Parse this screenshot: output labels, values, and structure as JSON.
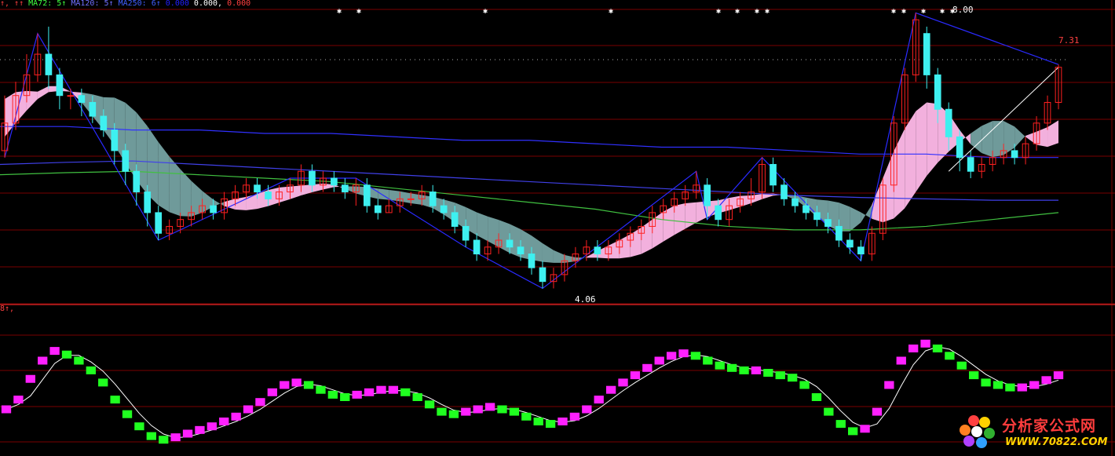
{
  "colors": {
    "bg": "#000000",
    "grid": "#7a0000",
    "up": "#ff2020",
    "down": "#3ef0f0",
    "pink": "#f2b0dd",
    "gray": "#6f9a9a",
    "zig": "#2a2aff",
    "zig2": "#ff40ff",
    "ma72": "#3030ff",
    "ma120": "#4040e8",
    "ma250": "#40c040",
    "osc_up": "#ff20ff",
    "osc_down": "#20ff20"
  },
  "legend": {
    "p1": "↑, ↑↑",
    "ma72": "MA72: 5↑",
    "ma120": "MA120: 5↑",
    "ma250": "MA250: 6↑",
    "v1": "0.000",
    "v2": "0.000,",
    "v3": "0.000",
    "p2": "8↑,"
  },
  "chart_data": [
    {
      "type": "candlestick",
      "annotations": {
        "high_label": "8.00",
        "low_label": "4.06",
        "last_label": "7.31"
      },
      "ylim": [
        3.9,
        8.15
      ],
      "candles": [
        [
          6.1,
          6.5,
          6.9,
          6.0
        ],
        [
          6.5,
          6.9,
          7.1,
          6.4
        ],
        [
          6.9,
          7.2,
          7.5,
          6.8
        ],
        [
          7.2,
          7.5,
          7.8,
          7.1
        ],
        [
          7.5,
          7.2,
          7.9,
          7.0
        ],
        [
          7.2,
          6.9,
          7.3,
          6.7
        ],
        [
          6.9,
          6.9,
          7.0,
          6.7
        ],
        [
          6.9,
          6.8,
          7.0,
          6.6
        ],
        [
          6.8,
          6.6,
          6.9,
          6.5
        ],
        [
          6.6,
          6.4,
          6.7,
          6.3
        ],
        [
          6.4,
          6.1,
          6.5,
          5.9
        ],
        [
          6.1,
          5.8,
          6.2,
          5.6
        ],
        [
          5.8,
          5.5,
          5.9,
          5.3
        ],
        [
          5.5,
          5.2,
          5.6,
          5.0
        ],
        [
          5.2,
          4.9,
          5.3,
          4.8
        ],
        [
          4.9,
          5.0,
          5.1,
          4.8
        ],
        [
          5.0,
          5.1,
          5.2,
          4.9
        ],
        [
          5.1,
          5.2,
          5.3,
          5.0
        ],
        [
          5.2,
          5.3,
          5.4,
          5.1
        ],
        [
          5.3,
          5.2,
          5.4,
          5.1
        ],
        [
          5.2,
          5.4,
          5.5,
          5.1
        ],
        [
          5.4,
          5.5,
          5.6,
          5.3
        ],
        [
          5.5,
          5.6,
          5.7,
          5.4
        ],
        [
          5.6,
          5.5,
          5.7,
          5.4
        ],
        [
          5.5,
          5.4,
          5.6,
          5.3
        ],
        [
          5.4,
          5.5,
          5.6,
          5.3
        ],
        [
          5.5,
          5.6,
          5.7,
          5.4
        ],
        [
          5.6,
          5.8,
          5.9,
          5.5
        ],
        [
          5.8,
          5.6,
          5.9,
          5.5
        ],
        [
          5.6,
          5.7,
          5.8,
          5.5
        ],
        [
          5.7,
          5.6,
          5.8,
          5.5
        ],
        [
          5.6,
          5.5,
          5.7,
          5.4
        ],
        [
          5.5,
          5.6,
          5.7,
          5.3
        ],
        [
          5.6,
          5.3,
          5.7,
          5.2
        ],
        [
          5.3,
          5.2,
          5.4,
          5.1
        ],
        [
          5.2,
          5.3,
          5.4,
          5.2
        ],
        [
          5.3,
          5.4,
          5.5,
          5.2
        ],
        [
          5.4,
          5.4,
          5.5,
          5.3
        ],
        [
          5.4,
          5.5,
          5.6,
          5.3
        ],
        [
          5.5,
          5.3,
          5.6,
          5.2
        ],
        [
          5.3,
          5.2,
          5.4,
          5.1
        ],
        [
          5.2,
          5.0,
          5.3,
          4.9
        ],
        [
          5.0,
          4.8,
          5.1,
          4.7
        ],
        [
          4.8,
          4.6,
          4.9,
          4.5
        ],
        [
          4.6,
          4.7,
          4.8,
          4.5
        ],
        [
          4.7,
          4.8,
          4.9,
          4.6
        ],
        [
          4.8,
          4.7,
          4.9,
          4.6
        ],
        [
          4.7,
          4.6,
          4.8,
          4.5
        ],
        [
          4.6,
          4.4,
          4.7,
          4.3
        ],
        [
          4.4,
          4.2,
          4.5,
          4.1
        ],
        [
          4.2,
          4.3,
          4.4,
          4.1
        ],
        [
          4.3,
          4.5,
          4.6,
          4.2
        ],
        [
          4.5,
          4.6,
          4.7,
          4.4
        ],
        [
          4.6,
          4.7,
          4.8,
          4.5
        ],
        [
          4.7,
          4.6,
          4.8,
          4.5
        ],
        [
          4.6,
          4.7,
          4.8,
          4.5
        ],
        [
          4.7,
          4.8,
          4.9,
          4.6
        ],
        [
          4.8,
          4.9,
          5.0,
          4.7
        ],
        [
          4.9,
          5.0,
          5.1,
          4.8
        ],
        [
          5.0,
          5.2,
          5.3,
          4.9
        ],
        [
          5.2,
          5.3,
          5.4,
          5.1
        ],
        [
          5.3,
          5.4,
          5.5,
          5.2
        ],
        [
          5.4,
          5.5,
          5.6,
          5.3
        ],
        [
          5.5,
          5.6,
          5.8,
          5.4
        ],
        [
          5.6,
          5.3,
          5.7,
          5.1
        ],
        [
          5.3,
          5.1,
          5.4,
          5.0
        ],
        [
          5.1,
          5.3,
          5.4,
          5.0
        ],
        [
          5.3,
          5.4,
          5.5,
          5.2
        ],
        [
          5.4,
          5.5,
          5.7,
          5.3
        ],
        [
          5.5,
          5.9,
          6.0,
          5.4
        ],
        [
          5.9,
          5.6,
          6.0,
          5.5
        ],
        [
          5.6,
          5.4,
          5.7,
          5.3
        ],
        [
          5.4,
          5.3,
          5.5,
          5.2
        ],
        [
          5.3,
          5.2,
          5.4,
          5.1
        ],
        [
          5.2,
          5.1,
          5.3,
          5.0
        ],
        [
          5.1,
          5.0,
          5.2,
          4.9
        ],
        [
          5.0,
          4.8,
          5.1,
          4.7
        ],
        [
          4.8,
          4.7,
          4.9,
          4.6
        ],
        [
          4.7,
          4.6,
          4.8,
          4.5
        ],
        [
          4.6,
          4.9,
          5.0,
          4.5
        ],
        [
          4.9,
          5.6,
          5.7,
          4.8
        ],
        [
          5.6,
          6.5,
          6.6,
          5.5
        ],
        [
          6.5,
          7.2,
          7.3,
          6.4
        ],
        [
          7.2,
          8.0,
          8.1,
          7.1
        ],
        [
          7.8,
          7.2,
          7.9,
          7.0
        ],
        [
          7.2,
          6.7,
          7.3,
          6.5
        ],
        [
          6.7,
          6.3,
          6.8,
          6.1
        ],
        [
          6.3,
          6.0,
          6.4,
          5.8
        ],
        [
          6.0,
          5.8,
          6.1,
          5.7
        ],
        [
          5.8,
          5.9,
          6.0,
          5.7
        ],
        [
          5.9,
          6.0,
          6.1,
          5.8
        ],
        [
          6.0,
          6.1,
          6.2,
          5.9
        ],
        [
          6.1,
          6.0,
          6.2,
          5.9
        ],
        [
          6.0,
          6.2,
          6.3,
          5.9
        ],
        [
          6.2,
          6.5,
          6.6,
          6.1
        ],
        [
          6.5,
          6.8,
          6.9,
          6.4
        ],
        [
          6.8,
          7.31,
          7.35,
          6.7
        ]
      ]
    },
    {
      "type": "line",
      "series": [
        {
          "name": "MA72",
          "values": [
            6.45,
            6.45,
            6.4,
            6.4,
            6.35,
            6.35,
            6.3,
            6.25,
            6.25,
            6.2,
            6.15,
            6.15,
            6.1,
            6.05,
            6.05,
            6.0,
            6.0
          ]
        },
        {
          "name": "MA120",
          "values": [
            5.9,
            5.93,
            5.95,
            5.9,
            5.85,
            5.8,
            5.75,
            5.7,
            5.65,
            5.6,
            5.55,
            5.5,
            5.45,
            5.42,
            5.4,
            5.38,
            5.38
          ]
        },
        {
          "name": "MA250",
          "values": [
            5.75,
            5.78,
            5.8,
            5.75,
            5.7,
            5.65,
            5.55,
            5.45,
            5.35,
            5.25,
            5.1,
            5.0,
            4.95,
            4.95,
            5.0,
            5.1,
            5.2
          ]
        }
      ]
    },
    {
      "type": "line",
      "ylim": [
        0,
        100
      ],
      "series": [
        {
          "name": "",
          "values": [
            30,
            38,
            55,
            70,
            78,
            75,
            70,
            62,
            52,
            38,
            26,
            16,
            8,
            5,
            7,
            10,
            13,
            16,
            20,
            24,
            30,
            36,
            44,
            50,
            52,
            50,
            46,
            42,
            40,
            42,
            44,
            46,
            46,
            44,
            40,
            34,
            28,
            26,
            28,
            30,
            32,
            30,
            28,
            24,
            20,
            18,
            20,
            24,
            30,
            38,
            46,
            52,
            58,
            64,
            70,
            74,
            76,
            74,
            70,
            66,
            64,
            62,
            62,
            60,
            58,
            56,
            50,
            40,
            28,
            18,
            12,
            14,
            28,
            50,
            70,
            80,
            84,
            80,
            74,
            66,
            58,
            52,
            50,
            48,
            48,
            50,
            54,
            58
          ]
        }
      ]
    }
  ]
}
